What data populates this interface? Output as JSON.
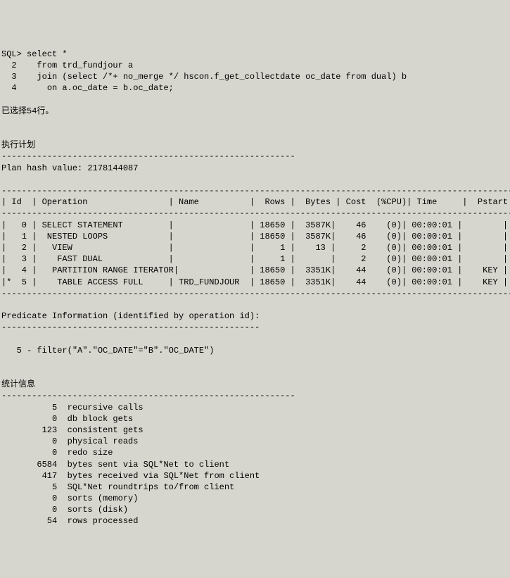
{
  "sql": {
    "prompt": "SQL>",
    "line1": "select *",
    "num2": "  2",
    "line2": "    from trd_fundjour a",
    "num3": "  3",
    "line3": "    join (select /*+ no_merge */ hscon.f_get_collectdate oc_date from dual) b",
    "num4": "  4",
    "line4": "      on a.oc_date = b.oc_date;"
  },
  "rows_selected": "已选择54行。",
  "plan_header": "执行计划",
  "plan_dash": "----------------------------------------------------------",
  "plan_hash": "Plan hash value: 2178144087",
  "table": {
    "hline": "------------------------------------------------------------------------------------------------------------------",
    "header": "| Id  | Operation                | Name          |  Rows |  Bytes | Cost  (%CPU)| Time     |  Pstart|  Pstop",
    "rows": [
      "|   0 | SELECT STATEMENT         |               | 18650 |  3587K|    46    (0)| 00:00:01 |        |       |",
      "|   1 |  NESTED LOOPS            |               | 18650 |  3587K|    46    (0)| 00:00:01 |        |       |",
      "|   2 |   VIEW                   |               |     1 |    13 |     2    (0)| 00:00:01 |        |       |",
      "|   3 |    FAST DUAL             |               |     1 |       |     2    (0)| 00:00:01 |        |       |",
      "|   4 |   PARTITION RANGE ITERATOR|              | 18650 |  3351K|    44    (0)| 00:00:01 |    KEY |    KEY",
      "|*  5 |    TABLE ACCESS FULL     | TRD_FUNDJOUR  | 18650 |  3351K|    44    (0)| 00:00:01 |    KEY |    KEY"
    ]
  },
  "predicate": {
    "title": "Predicate Information (identified by operation id):",
    "dash": "---------------------------------------------------",
    "line": "   5 - filter(\"A\".\"OC_DATE\"=\"B\".\"OC_DATE\")"
  },
  "stats": {
    "title": "统计信息",
    "dash": "----------------------------------------------------------",
    "rows": [
      "          5  recursive calls",
      "          0  db block gets",
      "        123  consistent gets",
      "          0  physical reads",
      "          0  redo size",
      "       6584  bytes sent via SQL*Net to client",
      "        417  bytes received via SQL*Net from client",
      "          5  SQL*Net roundtrips to/from client",
      "          0  sorts (memory)",
      "          0  sorts (disk)",
      "         54  rows processed"
    ]
  }
}
